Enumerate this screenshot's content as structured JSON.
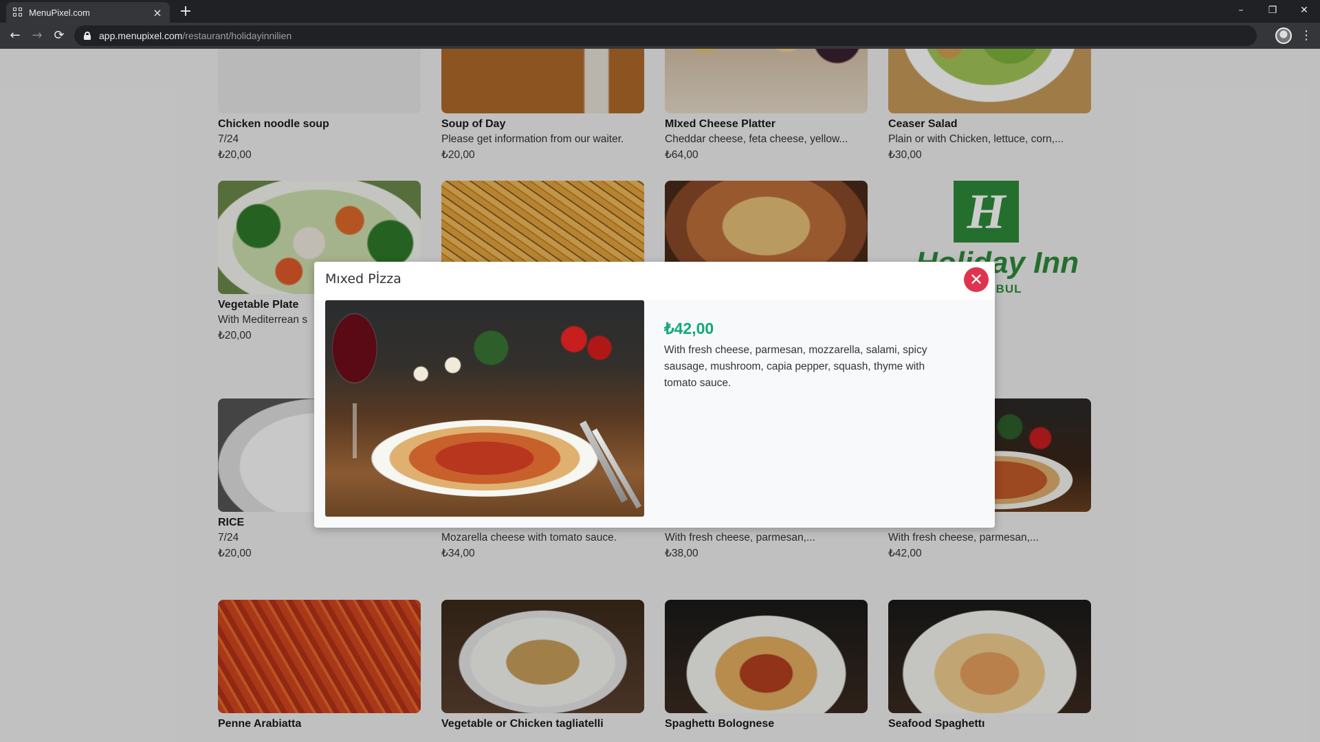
{
  "browser": {
    "tab_title": "MenuPixel.com",
    "tab_close_glyph": "×",
    "new_tab_glyph": "+",
    "url_domain": "app.menupixel.com",
    "url_path": "/restaurant/holidayinnilien",
    "back_glyph": "←",
    "forward_glyph": "→",
    "reload_glyph": "⟳",
    "bookmark_glyph": "☆",
    "menu_glyph": "⋮",
    "minimize_glyph": "–",
    "restore_glyph": "❐",
    "close_glyph": "✕"
  },
  "menu": {
    "items": [
      {
        "name": "Chicken noodle soup",
        "desc": "7/24",
        "price": "₺20,00",
        "image": "blank"
      },
      {
        "name": "Soup of Day",
        "desc": "Please get information from our waiter.",
        "price": "₺20,00",
        "image": "soup"
      },
      {
        "name": "MIxed Cheese Platter",
        "desc": "Cheddar cheese, feta cheese, yellow...",
        "price": "₺64,00",
        "image": "cheese"
      },
      {
        "name": "Ceaser Salad",
        "desc": "Plain or with Chicken, lettuce, corn,...",
        "price": "₺30,00",
        "image": "salad"
      },
      {
        "name": "Vegetable Plate",
        "desc": "With Mediterrean s",
        "price": "₺20,00",
        "image": "veg"
      },
      {
        "name": "",
        "desc": "",
        "price": "",
        "image": "fries"
      },
      {
        "name": "",
        "desc": "",
        "price": "",
        "image": "casserole"
      },
      {
        "name": "RICE",
        "desc": "7/24",
        "price": "₺20,00",
        "image": "rice"
      },
      {
        "name": "",
        "desc": "Mozarella cheese with tomato sauce.",
        "price": "₺34,00",
        "image": "blank"
      },
      {
        "name": "",
        "desc": "With fresh cheese, parmesan,...",
        "price": "₺38,00",
        "image": "blank"
      },
      {
        "name": "",
        "desc": "With fresh cheese, parmesan,...",
        "price": "₺42,00",
        "image": "pizza"
      },
      {
        "name": "Penne Arabiatta",
        "desc": "",
        "price": "",
        "image": "penne"
      },
      {
        "name": "Vegetable or Chicken tagliatelli",
        "desc": "",
        "price": "",
        "image": "tagliatelle"
      },
      {
        "name": "Spaghettı Bolognese",
        "desc": "",
        "price": "",
        "image": "bolognese"
      },
      {
        "name": "Seafood Spaghettı",
        "desc": "",
        "price": "",
        "image": "seafood"
      }
    ]
  },
  "logo": {
    "mark": "H",
    "wordmark": "Holiday Inn",
    "city": "ANBUL"
  },
  "modal": {
    "title": "Mıxed Pİzza",
    "price": "₺42,00",
    "description": "With fresh cheese, parmesan, mozzarella, salami, spicy sausage, mushroom, capia pepper, squash, thyme with tomato sauce.",
    "close_glyph": "✕"
  },
  "colors": {
    "price_accent": "#12a87a",
    "close_button": "#e0334e",
    "brand_green": "#2e8b3a"
  }
}
